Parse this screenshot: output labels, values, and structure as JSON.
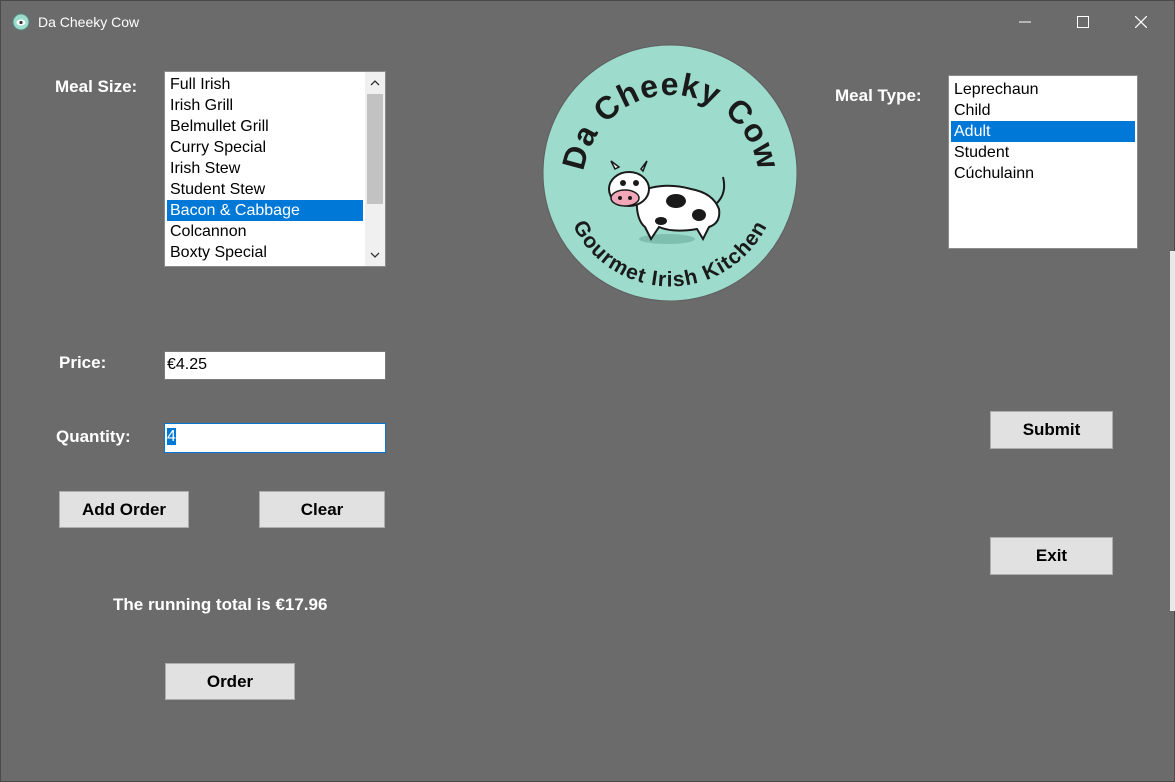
{
  "window": {
    "title": "Da Cheeky Cow",
    "minimize_glyph": "—",
    "maximize_glyph": "☐",
    "close_glyph": "✕"
  },
  "meal_size": {
    "label": "Meal Size:",
    "items": [
      "Full Irish",
      "Irish Grill",
      "Belmullet Grill",
      "Curry Special",
      "Irish Stew",
      "Student Stew",
      "Bacon & Cabbage",
      "Colcannon",
      "Boxty Special"
    ],
    "selected": "Bacon & Cabbage"
  },
  "meal_type": {
    "label": "Meal Type:",
    "items": [
      "Leprechaun",
      "Child",
      "Adult",
      "Student",
      "Cúchulainn"
    ],
    "selected": "Adult"
  },
  "logo": {
    "top_text": "Da Cheeky Cow",
    "bottom_text": "Gourmet Irish Kitchen",
    "colors": {
      "circle": "#9ddccd",
      "text": "#1a1a1a"
    }
  },
  "price": {
    "label": "Price:",
    "value": "€4.25"
  },
  "quantity": {
    "label": "Quantity:",
    "value": "4"
  },
  "buttons": {
    "add_order": "Add Order",
    "clear": "Clear",
    "submit": "Submit",
    "exit": "Exit",
    "order": "Order"
  },
  "running_total": "The running total is €17.96",
  "colors": {
    "background": "#6b6b6b",
    "selection": "#0078d7",
    "button": "#e1e1e1"
  }
}
